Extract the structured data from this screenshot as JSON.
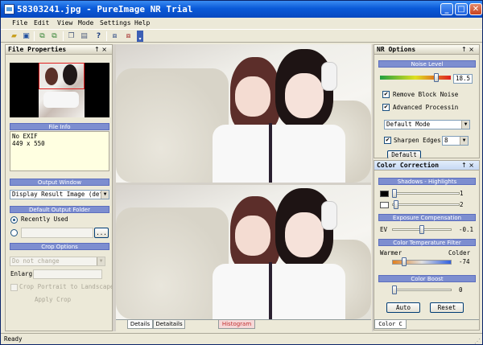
{
  "window": {
    "title": "58303241.jpg - PureImage NR Trial",
    "min": "_",
    "max": "□",
    "close": "✕"
  },
  "menu": [
    "File",
    "Edit",
    "View",
    "Mode",
    "Settings",
    "Help"
  ],
  "file_properties": {
    "title": "File Properties",
    "pin": "↑ ×",
    "file_info_header": "File Info",
    "file_info_lines": [
      "No EXIF",
      "449 x 550"
    ],
    "output_window_header": "Output Window",
    "output_window_value": "Display Result Image (def",
    "default_output_folder_header": "Default Output Folder",
    "recently_used": "Recently Used",
    "browse": "...",
    "crop_options_header": "Crop Options",
    "crop_value": "Do not change",
    "enlarge_label": "Enlarg",
    "crop_portrait": "Crop Portrait to Landscape",
    "apply_crop": "Apply Crop"
  },
  "nr_options": {
    "title": "NR Options",
    "pin": "↑ ×",
    "noise_level_header": "Noise Level",
    "noise_value": "18.5",
    "noise_level": 0.82,
    "remove_block_noise": "Remove Block Noise",
    "advanced_processing": "Advanced Processin",
    "mode_value": "Default Mode",
    "sharpen_edges": "Sharpen Edges",
    "sharpen_value": "8",
    "default_button": "Default"
  },
  "color_correction": {
    "title": "Color Correction",
    "pin": "↑ ×",
    "shadows_header": "Shadows - Highlights",
    "shadow_value": "1",
    "highlight_value": "2",
    "exposure_header": "Exposure Compensation",
    "ev_label": "EV",
    "ev_value": "-0.1",
    "temp_header": "Color Temperature Filter",
    "warmer": "Warmer",
    "colder": "Colder",
    "temp_value": "-74",
    "boost_header": "Color Boost",
    "boost_value": "0",
    "auto_button": "Auto",
    "reset_button": "Reset",
    "bottom_tab": "Color C"
  },
  "bottom_tabs": [
    "Details",
    "Detaitails",
    "Histogram"
  ],
  "status": "Ready",
  "colors": {
    "titlebar": "#0a5ad8",
    "section": "#7d8ed0",
    "info_bg": "#ffffe1"
  }
}
